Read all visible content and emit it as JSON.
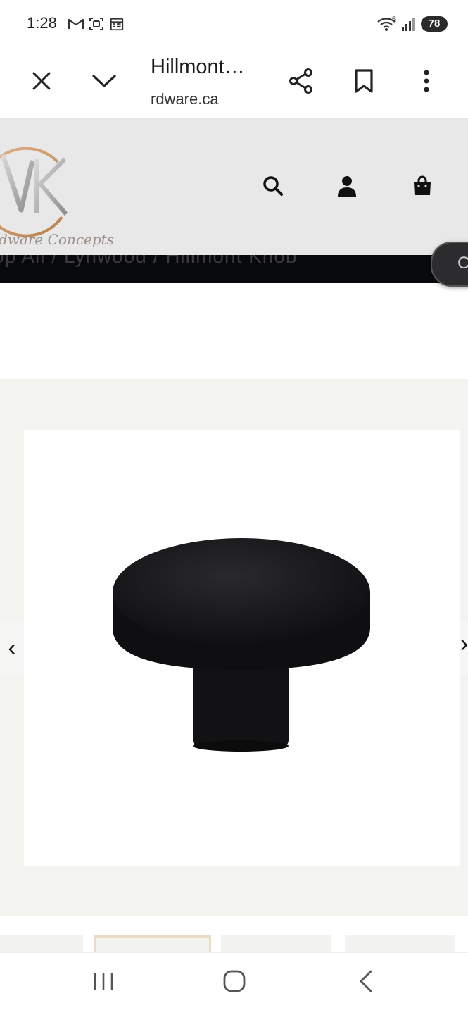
{
  "status_bar": {
    "time": "1:28",
    "battery": "78",
    "icons": [
      "gmail-icon",
      "screenshot-icon",
      "calendar-icon",
      "wifi-icon",
      "signal-icon"
    ]
  },
  "tab_header": {
    "title": "Hillmont…",
    "url": "rdware.ca",
    "icons": [
      "close-icon",
      "chevron-down-icon",
      "share-icon",
      "bookmark-icon",
      "more-vert-icon"
    ]
  },
  "site_header": {
    "logo_letters": "VK",
    "logo_script": "dware Concepts",
    "icons": [
      "search-icon",
      "account-icon",
      "bag-icon"
    ]
  },
  "breadcrumb": {
    "text": "op All  /  Lynwood  /  Hillmont Knob"
  },
  "floating_button": {
    "label": "C"
  },
  "gallery": {
    "prev_glyph": "‹",
    "next_glyph": "›",
    "image_alt": "Matte black round cabinet knob"
  },
  "android_nav": {
    "icons": [
      "recents-icon",
      "home-icon",
      "back-icon"
    ]
  },
  "colors": {
    "site_header_bg": "#e8e8e8",
    "breadcrumb_bg": "#08090c",
    "logo_gold": "#c9905e",
    "knob": "#141416"
  }
}
